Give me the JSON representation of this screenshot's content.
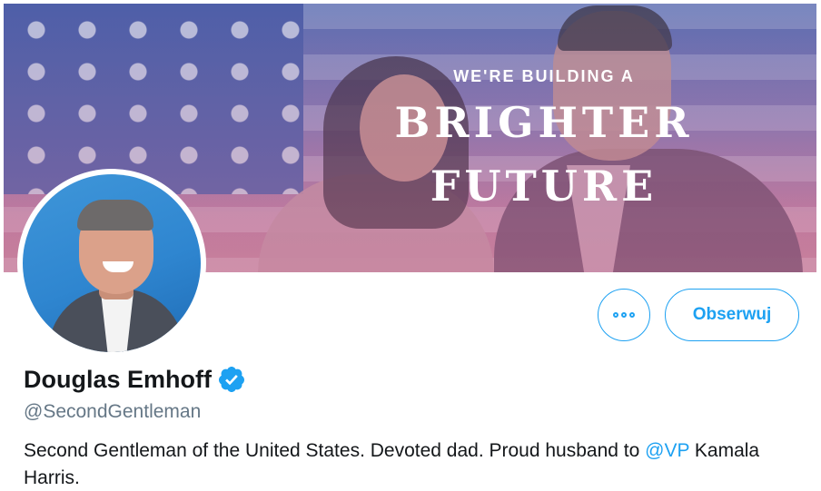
{
  "banner": {
    "kicker": "WE'RE BUILDING A",
    "line1": "BRIGHTER",
    "line2": "FUTURE"
  },
  "profile": {
    "name": "Douglas Emhoff",
    "handle": "@SecondGentleman",
    "verified": true,
    "bio_before": "Second Gentleman of the United States. Devoted dad. Proud husband to ",
    "bio_mention": "@VP",
    "bio_after": " Kamala Harris."
  },
  "actions": {
    "more_icon": "more-horizontal-icon",
    "follow_label": "Obserwuj"
  },
  "colors": {
    "accent": "#1da1f2",
    "text": "#14171a",
    "secondary_text": "#657786"
  }
}
